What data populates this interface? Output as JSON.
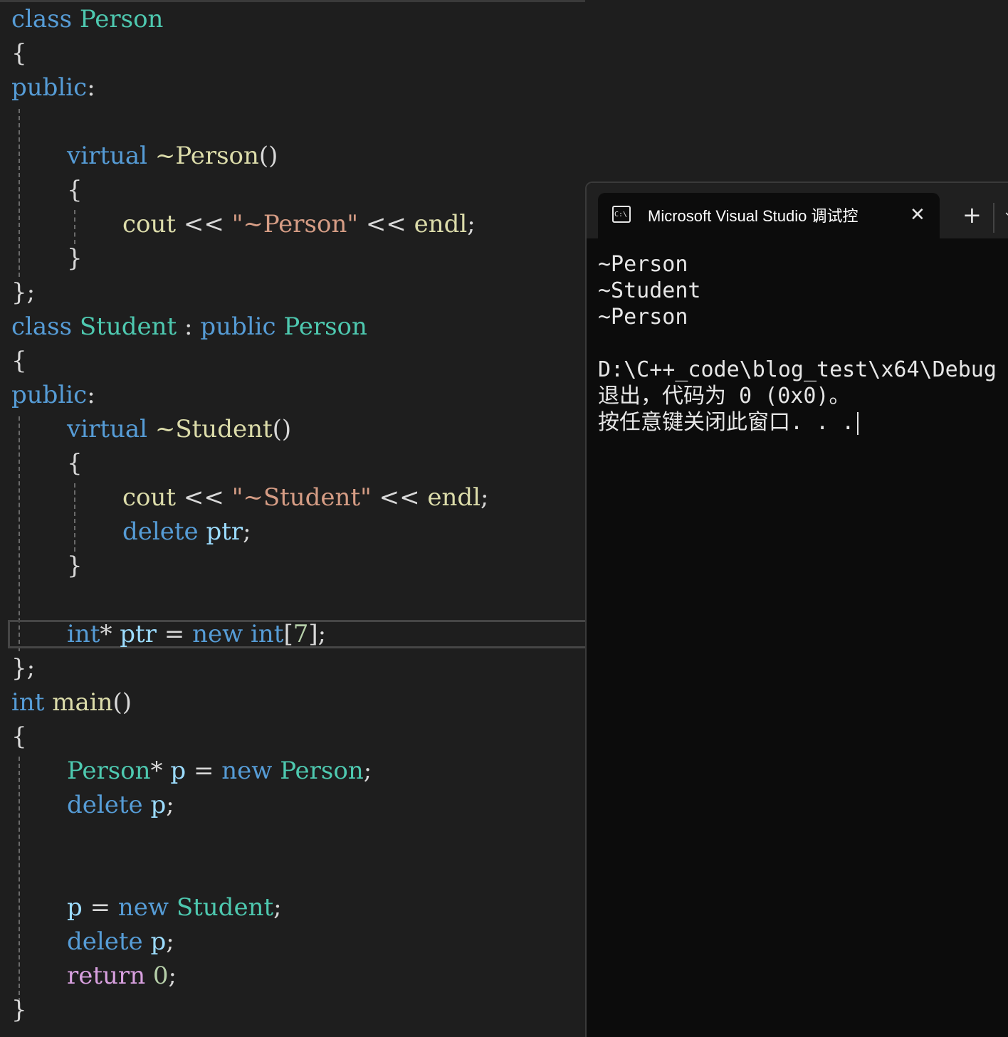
{
  "editor": {
    "l1": {
      "t0": "class",
      "t1": "Person"
    },
    "l2": {
      "t0": "{"
    },
    "l3": {
      "t0": "public",
      "t1": ":"
    },
    "l4": {
      "t0": "virtual",
      "t1": "~Person",
      "t2": "()"
    },
    "l5": {
      "t0": "{"
    },
    "l6": {
      "t0": "cout",
      "t1": "<<",
      "t2": "\"~Person\"",
      "t3": "<<",
      "t4": "endl",
      "t5": ";"
    },
    "l7": {
      "t0": "}"
    },
    "l8": {
      "t0": "};"
    },
    "l9": {
      "t0": "class",
      "t1": "Student",
      "t2": ":",
      "t3": "public",
      "t4": "Person"
    },
    "l10": {
      "t0": "{"
    },
    "l11": {
      "t0": "public",
      "t1": ":"
    },
    "l12": {
      "t0": "virtual",
      "t1": "~Student",
      "t2": "()"
    },
    "l13": {
      "t0": "{"
    },
    "l14": {
      "t0": "cout",
      "t1": "<<",
      "t2": "\"~Student\"",
      "t3": "<<",
      "t4": "endl",
      "t5": ";"
    },
    "l15": {
      "t0": "delete",
      "t1": "ptr",
      "t2": ";"
    },
    "l16": {
      "t0": "}"
    },
    "l17": {
      "t0": "int",
      "t1": "*",
      "t2": "ptr",
      "t3": "=",
      "t4": "new",
      "t5": "int",
      "t6": "[",
      "t7": "7",
      "t8": "]",
      "t9": ";"
    },
    "l18": {
      "t0": "};"
    },
    "l19": {
      "t0": "int",
      "t1": "main",
      "t2": "()"
    },
    "l20": {
      "t0": "{"
    },
    "l21": {
      "t0": "Person",
      "t1": "*",
      "t2": "p",
      "t3": "=",
      "t4": "new",
      "t5": "Person",
      "t6": ";"
    },
    "l22": {
      "t0": "delete",
      "t1": "p",
      "t2": ";"
    },
    "l23": {
      "t0": "p",
      "t1": "=",
      "t2": "new",
      "t3": "Student",
      "t4": ";"
    },
    "l24": {
      "t0": "delete",
      "t1": "p",
      "t2": ";"
    },
    "l25": {
      "t0": "return",
      "t1": "0",
      "t2": ";"
    },
    "l26": {
      "t0": "}"
    }
  },
  "terminal": {
    "tab_icon": "terminal-icon",
    "tab_icon_text": "C:\\",
    "tab_title": "Microsoft Visual Studio 调试控",
    "close_glyph": "✕",
    "new_tab_glyph": "+",
    "dropdown_glyph": "⌄",
    "output": [
      "~Person",
      "~Student",
      "~Person",
      "",
      "D:\\C++_code\\blog_test\\x64\\Debug",
      "退出，代码为 0 (0x0)。",
      "按任意键关闭此窗口. . ."
    ]
  },
  "colors": {
    "background": "#1e1e1e",
    "keyword": "#569cd6",
    "type": "#4ec9b0",
    "function": "#dcdcaa",
    "string": "#d69d85",
    "number": "#b5cea8",
    "control": "#d8a0df",
    "terminal_bg": "#0c0c0c"
  }
}
